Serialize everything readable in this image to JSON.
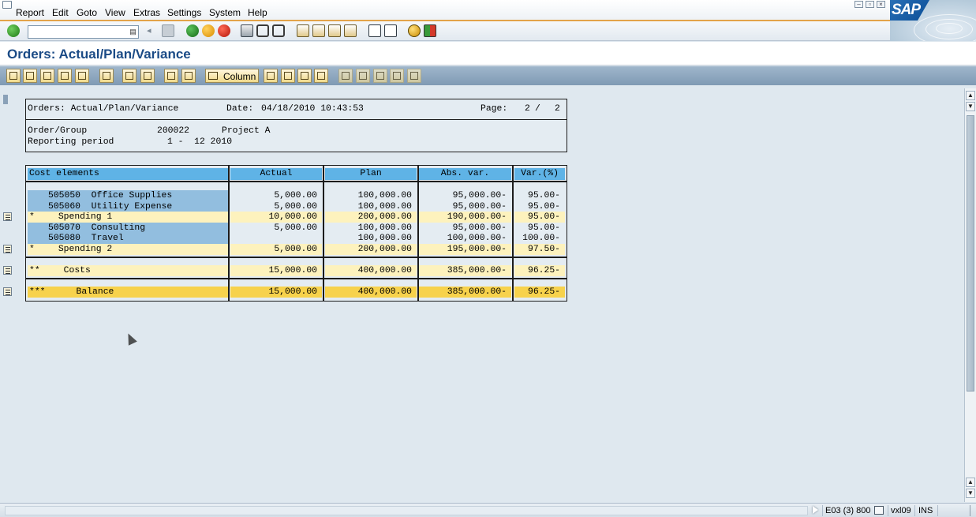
{
  "menu": [
    "Report",
    "Edit",
    "Goto",
    "View",
    "Extras",
    "Settings",
    "System",
    "Help"
  ],
  "title": "Orders: Actual/Plan/Variance",
  "app_toolbar": {
    "column_label": "Column"
  },
  "report_header": {
    "title": "Orders: Actual/Plan/Variance",
    "date_label": "Date:",
    "date_value": "04/18/2010 10:43:53",
    "page_label": "Page:",
    "page_current": "2",
    "page_sep": "/",
    "page_total": "2",
    "order_group_label": "Order/Group",
    "order_group_value": "200022",
    "order_group_desc": "Project A",
    "reporting_period_label": "Reporting period",
    "reporting_period_value": "1 -  12 2010"
  },
  "report_table": {
    "columns": [
      "Cost elements",
      "Actual",
      "Plan",
      "Abs. var.",
      "Var.(%)"
    ],
    "rows": [
      {
        "level": "",
        "label": "505050  Office Supplies",
        "actual": "5,000.00",
        "plan": "100,000.00",
        "abs_var": "95,000.00-",
        "var_pct": "95.00-"
      },
      {
        "level": "",
        "label": "505060  Utility Expense",
        "actual": "5,000.00",
        "plan": "100,000.00",
        "abs_var": "95,000.00-",
        "var_pct": "95.00-"
      },
      {
        "level": "*",
        "label": "Spending 1",
        "actual": "10,000.00",
        "plan": "200,000.00",
        "abs_var": "190,000.00-",
        "var_pct": "95.00-"
      },
      {
        "level": "",
        "label": "505070  Consulting",
        "actual": "5,000.00",
        "plan": "100,000.00",
        "abs_var": "95,000.00-",
        "var_pct": "95.00-"
      },
      {
        "level": "",
        "label": "505080  Travel",
        "actual": "",
        "plan": "100,000.00",
        "abs_var": "100,000.00-",
        "var_pct": "100.00-"
      },
      {
        "level": "*",
        "label": "Spending 2",
        "actual": "5,000.00",
        "plan": "200,000.00",
        "abs_var": "195,000.00-",
        "var_pct": "97.50-"
      },
      {
        "level": "**",
        "label": "Costs",
        "actual": "15,000.00",
        "plan": "400,000.00",
        "abs_var": "385,000.00-",
        "var_pct": "96.25-"
      },
      {
        "level": "***",
        "label": "Balance",
        "actual": "15,000.00",
        "plan": "400,000.00",
        "abs_var": "385,000.00-",
        "var_pct": "96.25-"
      }
    ]
  },
  "status_bar": {
    "system": "E03 (3) 800",
    "server": "vxl09",
    "mode": "INS"
  },
  "colors": {
    "header_blue": "#5fb3e6",
    "item_blue": "#92bedf",
    "subtotal_yellow": "#fdf2bd",
    "total_yellow": "#f7d24c",
    "title_blue": "#1b4b86"
  },
  "icons": [
    "enter-icon",
    "back-icon",
    "exit-icon",
    "cancel-icon",
    "print-icon",
    "find-icon",
    "find-next-icon",
    "first-page-icon",
    "prev-page-icon",
    "next-page-icon",
    "last-page-icon",
    "new-session-icon",
    "shortcut-icon",
    "help-icon",
    "layout-icon"
  ]
}
